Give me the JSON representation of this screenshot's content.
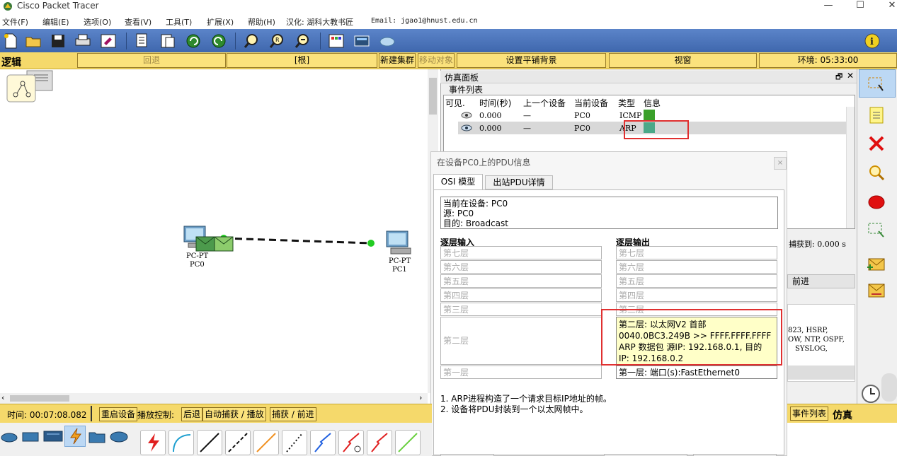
{
  "window": {
    "title": "Cisco Packet Tracer",
    "minimize": "—",
    "maximize": "☐",
    "close": "✕"
  },
  "menu": {
    "items": [
      "文件(F)",
      "编辑(E)",
      "选项(O)",
      "查看(V)",
      "工具(T)",
      "扩展(X)",
      "帮助(H)",
      "汉化: 湖科大教书匠",
      "Email: jgao1@hnust.edu.cn"
    ]
  },
  "logicbar": {
    "logic_label": "逻辑",
    "back": "回退",
    "root": "[根]",
    "new_cluster": "新建集群",
    "move_object": "移动对象",
    "set_tiled_bg": "设置平铺背景",
    "viewport": "视窗",
    "env": "环境: 05:33:00"
  },
  "topology": {
    "pc0_type": "PC-PT",
    "pc0_name": "PC0",
    "pc1_type": "PC-PT",
    "pc1_name": "PC1"
  },
  "simulation": {
    "panel_title": "仿真面板",
    "event_list_label": "事件列表",
    "columns": [
      "可见.",
      "时间(秒)",
      "上一个设备",
      "当前设备",
      "类型",
      "信息"
    ],
    "events": [
      {
        "time": "0.000",
        "last": "—",
        "current": "PC0",
        "type": "ICMP",
        "color": "#3aa02a"
      },
      {
        "time": "0.000",
        "last": "—",
        "current": "PC0",
        "type": "ARP",
        "color": "#4aa888"
      }
    ],
    "captured_label": "捕获到: 0.000 s",
    "forward_label": "前进",
    "protocols_line1": "823, HSRP,",
    "protocols_line2": "OW, NTP, OSPF,",
    "protocols_line3": "SYSLOG,"
  },
  "pdu": {
    "title": "在设备PC0上的PDU信息",
    "tab_osi": "OSI 模型",
    "tab_outbound": "出站PDU详情",
    "info_line1": "当前在设备: PC0",
    "info_line2": "源: PC0",
    "info_line3": "目的: Broadcast",
    "in_layers_header": "逐层输入",
    "out_layers_header": "逐层输出",
    "layer7": "第七层",
    "layer6": "第六层",
    "layer5": "第五层",
    "layer4": "第四层",
    "layer3": "第三层",
    "layer2": "第二层",
    "layer1": "第一层",
    "out_layer2_line1": "第二层: 以太网V2 首部",
    "out_layer2_line2": "0040.0BC3.249B >> FFFF.FFFF.FFFF",
    "out_layer2_line3": "ARP 数据包 源IP: 192.168.0.1, 目的",
    "out_layer2_line4": "IP: 192.168.0.2",
    "out_layer1": "第一层: 端口(s):FastEthernet0",
    "desc1": "1. ARP进程构造了一个请求目标IP地址的帧。",
    "desc2": "2. 设备将PDU封装到一个以太网帧中。"
  },
  "bottom": {
    "time_label": "时间: 00:07:08.082",
    "restart": "重启设备",
    "playback": "播放控制:",
    "back": "后退",
    "auto_capture": "自动捕获 / 播放",
    "capture_forward": "捕获 / 前进",
    "event_list": "事件列表",
    "simulation": "仿真"
  }
}
